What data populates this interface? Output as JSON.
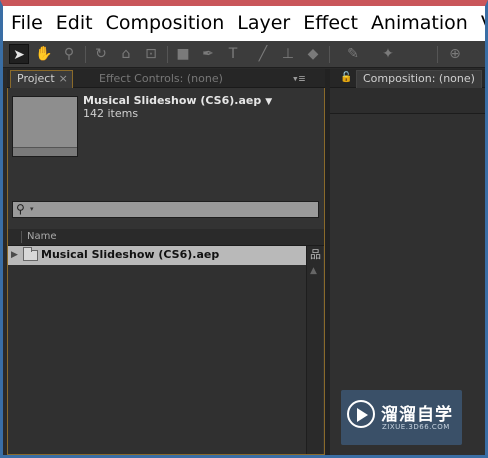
{
  "menubar": {
    "items": [
      "File",
      "Edit",
      "Composition",
      "Layer",
      "Effect",
      "Animation",
      "View"
    ]
  },
  "toolbar": {
    "tools": [
      {
        "icon": "selection-tool-icon",
        "glyph": "➤",
        "selected": true
      },
      {
        "icon": "hand-tool-icon",
        "glyph": "✋",
        "selected": false
      },
      {
        "icon": "zoom-tool-icon",
        "glyph": "⚲",
        "selected": false
      },
      {
        "icon": "rotate-tool-icon",
        "glyph": "↻",
        "selected": false
      },
      {
        "icon": "camera-tool-icon",
        "glyph": "⌂",
        "selected": false
      },
      {
        "icon": "pan-behind-tool-icon",
        "glyph": "⊡",
        "selected": false
      },
      {
        "icon": "rectangle-tool-icon",
        "glyph": "■",
        "selected": false
      },
      {
        "icon": "pen-tool-icon",
        "glyph": "✒",
        "selected": false
      },
      {
        "icon": "type-tool-icon",
        "glyph": "T",
        "selected": false
      },
      {
        "icon": "brush-tool-icon",
        "glyph": "╱",
        "selected": false
      },
      {
        "icon": "clone-stamp-tool-icon",
        "glyph": "⊥",
        "selected": false
      },
      {
        "icon": "eraser-tool-icon",
        "glyph": "◆",
        "selected": false
      },
      {
        "icon": "roto-brush-tool-icon",
        "glyph": "✎",
        "selected": false
      },
      {
        "icon": "puppet-pin-tool-icon",
        "glyph": "✦",
        "selected": false
      },
      {
        "icon": "local-axis-icon",
        "glyph": "⊕",
        "selected": false
      }
    ]
  },
  "project_panel": {
    "tab_label": "Project",
    "tab_close": "×",
    "effect_controls_tab": "Effect Controls: (none)",
    "panel_menu": "▾≡",
    "project_name": "Musical Slideshow (CS6).aep",
    "project_name_arrow": "▼",
    "item_count": "142 items",
    "search_icon_glyph": "⚲",
    "search_caret": "▾",
    "column_name": "Name",
    "rows": [
      {
        "label": "Musical Slideshow (CS6).aep",
        "expand_glyph": "▶"
      }
    ],
    "flowchart_glyph": "品",
    "scroll_up_glyph": "▲"
  },
  "composition_panel": {
    "lock_glyph": "🔓",
    "tab_label": "Composition: (none)"
  },
  "watermark": {
    "title": "溜溜自学",
    "url": "ZIXUE.3D66.COM"
  },
  "colors": {
    "menubar_bg": "#ffffff",
    "panel_bg": "#333333",
    "selected_row": "#b9b9b9",
    "active_panel_border": "#8a6a2a",
    "watermark_bg": "#3a5068",
    "frame_top": "#c9565a",
    "frame_side": "#3a6ea5"
  }
}
